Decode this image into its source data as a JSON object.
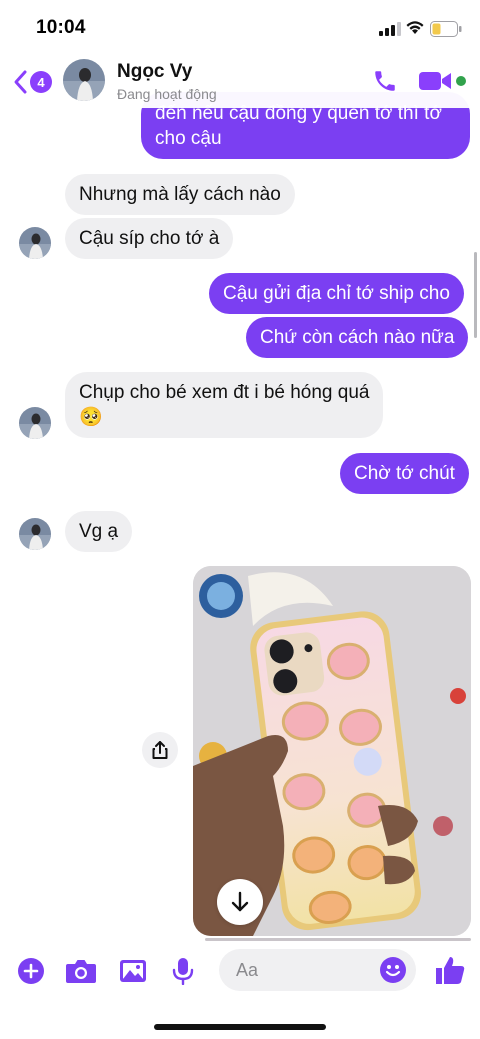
{
  "status_bar": {
    "time": "10:04"
  },
  "header": {
    "back_count": "4",
    "contact_name": "Ngọc Vy",
    "contact_status": "Đang hoạt động"
  },
  "messages": [
    {
      "side": "out",
      "lines": [
        "đến nếu cậu đồng ý quen tớ thì tớ",
        "cho cậu"
      ]
    },
    {
      "side": "in",
      "text": "Nhưng mà lấy cách nào"
    },
    {
      "side": "in",
      "text": "Cậu síp cho tớ à"
    },
    {
      "side": "out",
      "text": "Cậu gửi địa chỉ tớ ship cho"
    },
    {
      "side": "out",
      "text": "Chứ còn cách nào nữa"
    },
    {
      "side": "in",
      "lines": [
        "Chụp cho bé xem đt i bé hóng quá",
        "🥺"
      ]
    },
    {
      "side": "out",
      "text": "Chờ tớ chút"
    },
    {
      "side": "in",
      "text": "Vg ạ"
    }
  ],
  "composer": {
    "placeholder": "Aa"
  },
  "colors": {
    "accent": "#7b3ff2",
    "incoming_bubble": "#efeff1",
    "online": "#31a24c"
  }
}
